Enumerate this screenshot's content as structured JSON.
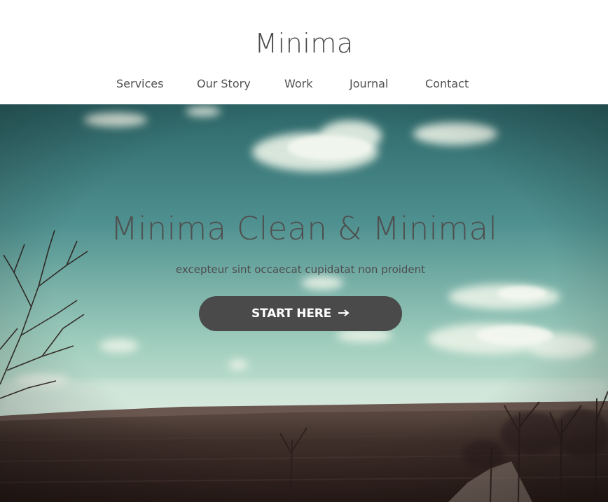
{
  "header": {
    "brand": "Minima",
    "nav": [
      {
        "label": "Services"
      },
      {
        "label": "Our Story"
      },
      {
        "label": "Work"
      },
      {
        "label": "Journal"
      },
      {
        "label": "Contact"
      }
    ]
  },
  "hero": {
    "title": "Minima Clean & Minimal",
    "subtitle": "excepteur sint occaecat cupidatat non proident",
    "cta_label": "START HERE",
    "cta_icon": "arrow-right-icon"
  },
  "colors": {
    "text": "#4b4b4b",
    "button_bg": "#4a4a4a",
    "button_text": "#ffffff",
    "sky_top": "#2f6a6c",
    "sky_bottom": "#cfe6d8",
    "field": "#3a2a26"
  }
}
